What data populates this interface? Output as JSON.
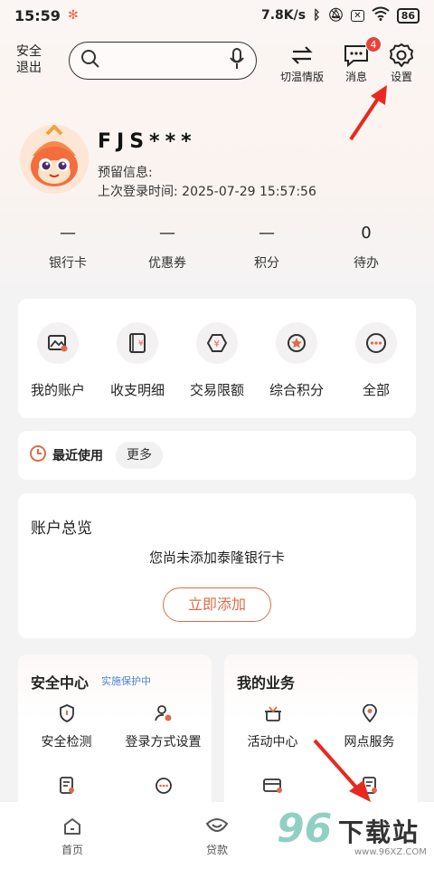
{
  "status_bar": {
    "time": "15:59",
    "speed": "7.8K/s",
    "battery": "86"
  },
  "header": {
    "logout_label": "安全\n退出",
    "search_placeholder": "",
    "switch_label": "切温情版",
    "message_label": "消息",
    "message_badge": "4",
    "settings_label": "设置"
  },
  "profile": {
    "name": "FJS***",
    "reserved_info": "预留信息:",
    "last_login": "上次登录时间: 2025-07-29 15:57:56"
  },
  "stats": [
    {
      "value": "—",
      "label": "银行卡"
    },
    {
      "value": "—",
      "label": "优惠券"
    },
    {
      "value": "—",
      "label": "积分"
    },
    {
      "value": "0",
      "label": "待办"
    }
  ],
  "quick_actions": [
    {
      "label": "我的账户",
      "icon": "image-card-icon"
    },
    {
      "label": "收支明细",
      "icon": "ledger-icon"
    },
    {
      "label": "交易限额",
      "icon": "hexagon-yen-icon"
    },
    {
      "label": "综合积分",
      "icon": "star-icon"
    },
    {
      "label": "全部",
      "icon": "more-dots-icon"
    }
  ],
  "recent": {
    "title": "最近使用",
    "more": "更多"
  },
  "account_overview": {
    "title": "账户总览",
    "message": "您尚未添加泰隆银行卡",
    "add_button": "立即添加"
  },
  "security_center": {
    "title": "安全中心",
    "subtitle": "实施保护中",
    "items": [
      {
        "label": "安全检测",
        "icon": "shield-icon"
      },
      {
        "label": "登录方式设置",
        "icon": "user-gear-icon"
      },
      {
        "label": "",
        "icon": "document-icon"
      },
      {
        "label": "",
        "icon": "more-dots-icon"
      }
    ]
  },
  "my_business": {
    "title": "我的业务",
    "items": [
      {
        "label": "活动中心",
        "icon": "gift-icon"
      },
      {
        "label": "网点服务",
        "icon": "location-pin-icon"
      },
      {
        "label": "",
        "icon": "card-icon"
      },
      {
        "label": "",
        "icon": "document-icon"
      }
    ]
  },
  "bottom_nav": [
    {
      "label": "首页",
      "icon": "home-icon"
    },
    {
      "label": "贷款",
      "icon": "loan-icon"
    },
    {
      "label": "",
      "icon": ""
    }
  ],
  "watermark": {
    "number": "96",
    "text": "下载站",
    "url": "www.96XZ.COM"
  },
  "colors": {
    "accent": "#e06b49",
    "badge": "#e8423a",
    "link_blue": "#4a7fd8"
  }
}
